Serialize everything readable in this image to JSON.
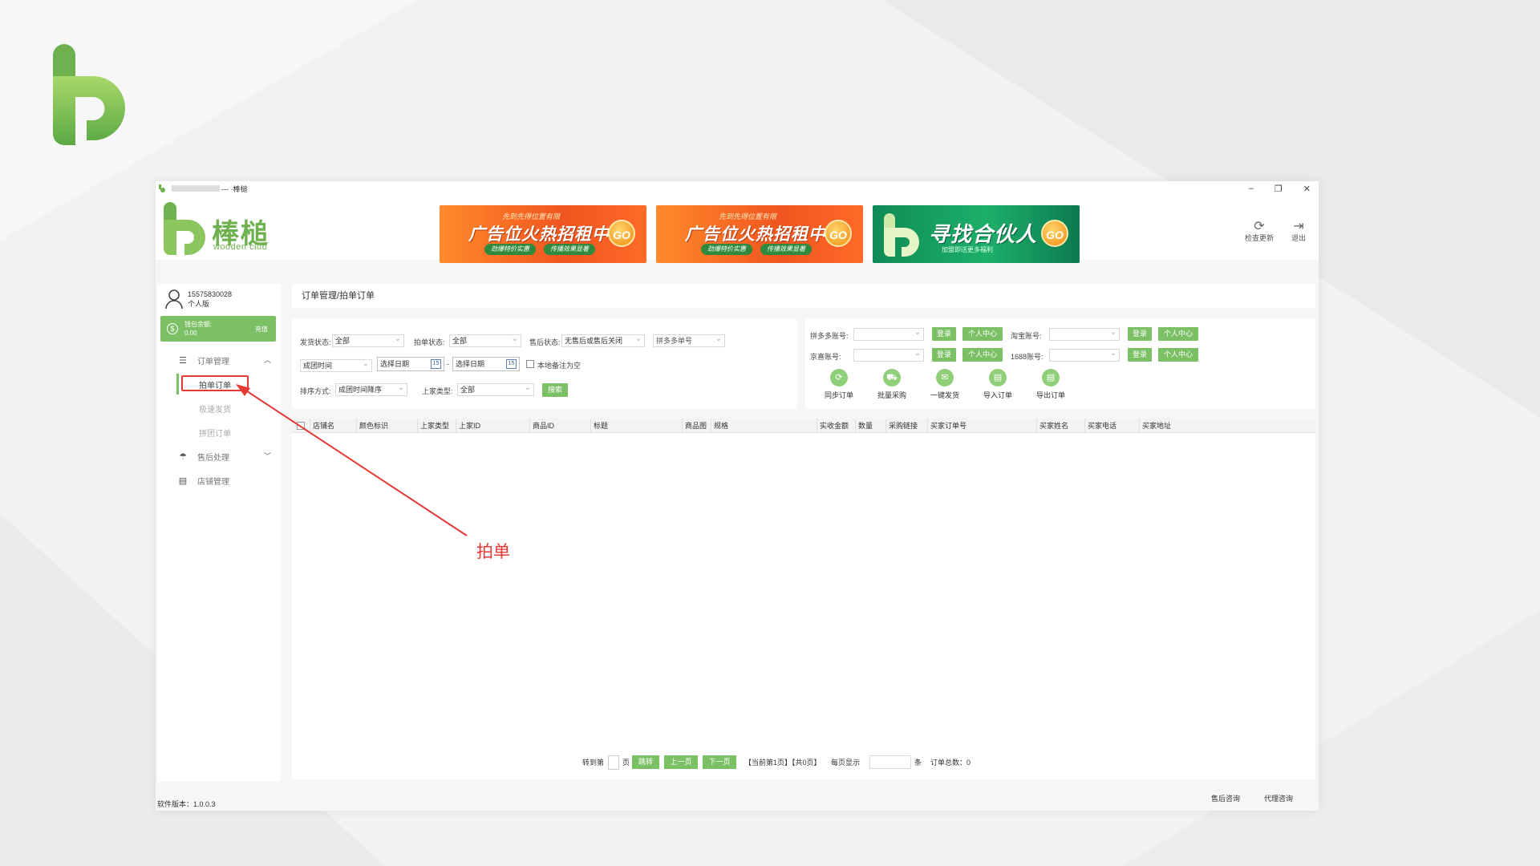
{
  "window": {
    "title": "--- ·棒槌",
    "controls": {
      "minimize": "–",
      "restore": "❐",
      "close": "✕"
    }
  },
  "brand": {
    "name": "棒槌",
    "sub": "wooden club",
    "color": "#6eb14e"
  },
  "banners": [
    {
      "top": "先到先得位置有限",
      "main": "广告位火热招租中",
      "pill1": "劲爆特价实惠",
      "pill2": "传播效果显著",
      "go": "GO"
    },
    {
      "top": "先到先得位置有限",
      "main": "广告位火热招租中",
      "pill1": "劲爆特价实惠",
      "pill2": "传播效果显著",
      "go": "GO"
    },
    {
      "main": "寻找合伙人",
      "sub": "加盟即送更多福利",
      "go": "GO"
    }
  ],
  "header_tools": {
    "check_update": "检查更新",
    "logout": "退出"
  },
  "user": {
    "phone": "15575830028",
    "edition": "个人版"
  },
  "balance": {
    "label": "钱包余额:",
    "amount": "0.00",
    "recharge": "充值"
  },
  "menu": {
    "order_mgmt": "订单管理",
    "sub": [
      "拍单订单",
      "极速发货",
      "拼团订单"
    ],
    "after_sale": "售后处理",
    "shop_mgmt": "店铺管理"
  },
  "breadcrumb": "订单管理/拍单订单",
  "filters": {
    "ship_status_label": "发货状态:",
    "ship_status_value": "全部",
    "order_status_label": "拍单状态:",
    "order_status_value": "全部",
    "after_sale_label": "售后状态:",
    "after_sale_value": "无售后或售后关闭",
    "pdd_order_placeholder": "拼多多单号",
    "time_type_value": "成团时间",
    "date_start_placeholder": "选择日期",
    "date_sep": "-",
    "date_end_placeholder": "选择日期",
    "remark_empty_label": "本地备注为空",
    "sort_label": "排序方式:",
    "sort_value": "成团时间降序",
    "supplier_type_label": "上家类型:",
    "supplier_type_value": "全部",
    "search_button": "搜索"
  },
  "accounts": {
    "pdd_label": "拼多多账号:",
    "taobao_label": "淘宝账号:",
    "jd_label": "京喜账号:",
    "ali1688_label": "1688账号:",
    "login": "登录",
    "center": "个人中心"
  },
  "actions": [
    "同步订单",
    "批量采购",
    "一键发货",
    "导入订单",
    "导出订单"
  ],
  "table": {
    "columns": [
      "店铺名",
      "颜色标识",
      "上家类型",
      "上家ID",
      "商品ID",
      "标题",
      "商品图",
      "规格",
      "实收金额",
      "数量",
      "采购链接",
      "买家订单号",
      "买家姓名",
      "买家电话",
      "买家地址"
    ]
  },
  "pager": {
    "goto": "转到第",
    "page_unit": "页",
    "jump": "跳转",
    "prev": "上一页",
    "next": "下一页",
    "status": "【当前第1页】【共0页】",
    "per_page": "每页显示",
    "per_unit": "条",
    "total": "订单总数：0"
  },
  "footer": {
    "version": "软件版本：1.0.0.3",
    "after_sale_consult": "售后咨询",
    "agent_consult": "代理咨询"
  },
  "annotation": {
    "label": "拍单",
    "color": "#e53935"
  }
}
